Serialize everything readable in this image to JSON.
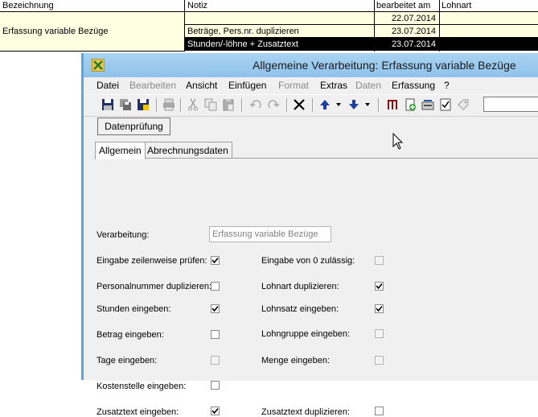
{
  "grid": {
    "headers": {
      "bezeichnung": "Bezeichnung",
      "notiz": "Notiz",
      "bearbeitet": "bearbeitet am",
      "lohnart": "Lohnart"
    },
    "bezeichnung_value": "Erfassung variable Bezüge",
    "rows": [
      {
        "notiz": "",
        "bearbeitet": "22.07.2014",
        "lohnart": ""
      },
      {
        "notiz": "Beträge, Pers.nr. duplizieren",
        "bearbeitet": "23.07.2014",
        "lohnart": ""
      },
      {
        "notiz": "Stunden/-löhne + Zusatztext",
        "bearbeitet": "23.07.2014",
        "lohnart": ""
      }
    ]
  },
  "window": {
    "title": "Allgemeine Verarbeitung: Erfassung variable Bezüge",
    "menu": [
      {
        "label": "Datei",
        "enabled": true
      },
      {
        "label": "Bearbeiten",
        "enabled": false
      },
      {
        "label": "Ansicht",
        "enabled": true
      },
      {
        "label": "Einfügen",
        "enabled": true
      },
      {
        "label": "Format",
        "enabled": false
      },
      {
        "label": "Extras",
        "enabled": true
      },
      {
        "label": "Daten",
        "enabled": false
      },
      {
        "label": "Erfassung",
        "enabled": true
      },
      {
        "label": "?",
        "enabled": true
      }
    ],
    "toolbar_icons": [
      "save-icon",
      "save-all-icon",
      "save-close-icon",
      "print-icon",
      "cut-icon",
      "copy-icon",
      "paste-icon",
      "undo-icon",
      "redo-icon",
      "delete-icon",
      "move-up-icon",
      "move-down-icon",
      "book-icon",
      "new-doc-icon",
      "import-icon",
      "checklist-icon",
      "tag-icon"
    ],
    "datenpruefung_label": "Datenprüfung",
    "tabs": [
      {
        "label": "Allgemein",
        "active": true
      },
      {
        "label": "Abrechnungsdaten",
        "active": false
      }
    ],
    "form": {
      "verarbeitung_label": "Verarbeitung:",
      "verarbeitung_value": "Erfassung variable Bezüge",
      "checks": [
        {
          "label": "Eingabe zeilenweise prüfen:",
          "checked": true,
          "enabled": true
        },
        {
          "label": "Eingabe von 0 zulässig:",
          "checked": false,
          "enabled": false
        },
        {
          "label": "Personalnummer duplizieren:",
          "checked": false,
          "enabled": true
        },
        {
          "label": "Lohnart duplizieren:",
          "checked": true,
          "enabled": true
        },
        {
          "label": "Stunden eingeben:",
          "checked": true,
          "enabled": true
        },
        {
          "label": "Lohnsatz eingeben:",
          "checked": true,
          "enabled": true
        },
        {
          "label": "Betrag eingeben:",
          "checked": false,
          "enabled": true
        },
        {
          "label": "Lohngruppe eingeben:",
          "checked": false,
          "enabled": false
        },
        {
          "label": "Tage eingeben:",
          "checked": false,
          "enabled": false
        },
        {
          "label": "Menge eingeben:",
          "checked": false,
          "enabled": false
        },
        {
          "label": "Kostenstelle eingeben:",
          "checked": false,
          "enabled": true
        },
        {
          "label": "Zusatztext eingeben:",
          "checked": true,
          "enabled": true
        },
        {
          "label": "Zusatztext duplizieren:",
          "checked": false,
          "enabled": true
        }
      ]
    }
  }
}
